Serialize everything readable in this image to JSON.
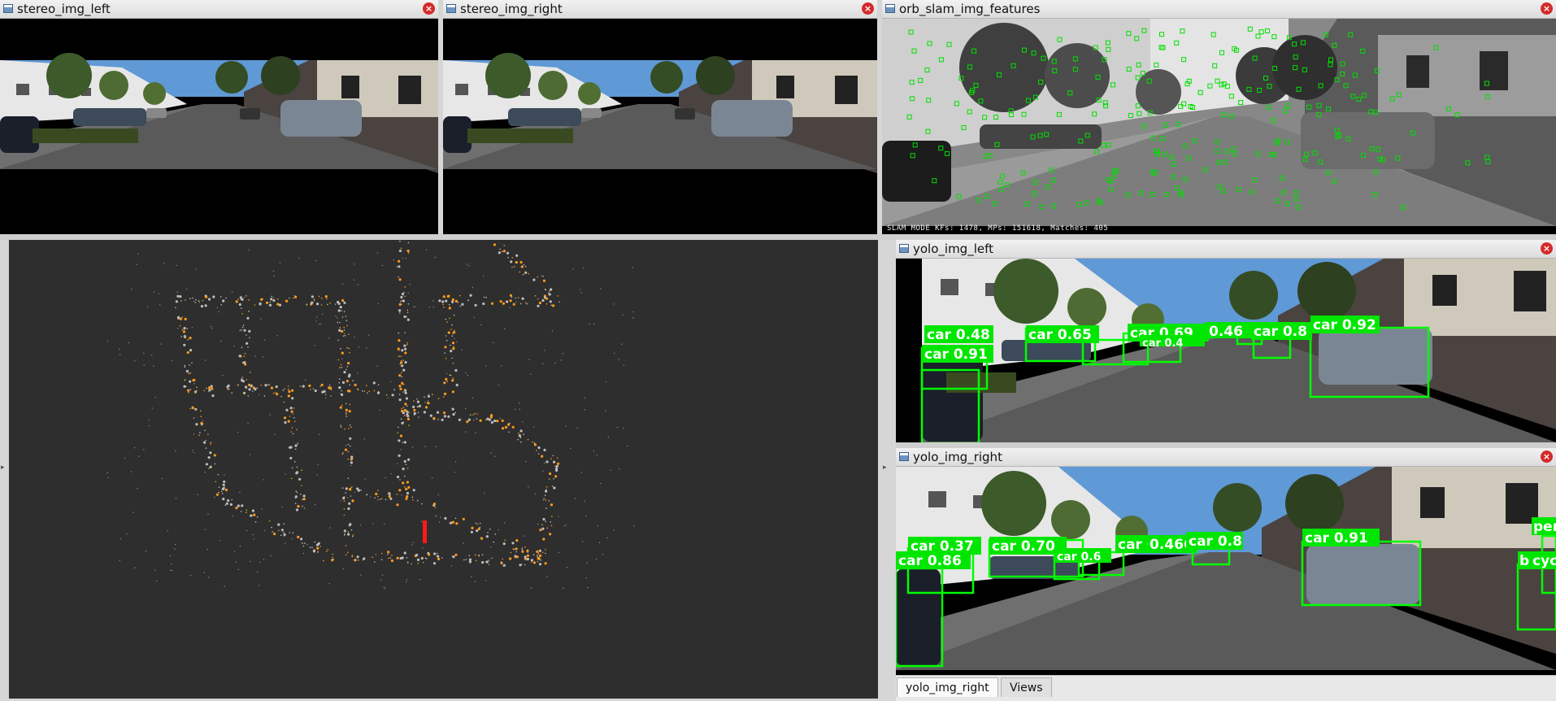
{
  "windows": {
    "stereo_left": {
      "title": "stereo_img_left",
      "close": "×"
    },
    "stereo_right": {
      "title": "stereo_img_right",
      "close": "×"
    },
    "orb_features": {
      "title": "orb_slam_img_features",
      "close": "×",
      "status_text": "SLAM MODE   KFs: 1478, MPs: 151618, Matches: 405"
    },
    "yolo_left": {
      "title": "yolo_img_left",
      "close": "×"
    },
    "yolo_right": {
      "title": "yolo_img_right",
      "close": "×"
    }
  },
  "yolo_left_detections": [
    "car 0.48",
    "car 0.91",
    "car 0.65",
    "car 0.69",
    "car 0.4",
    "0.46",
    "car 0.8",
    "car 0.92"
  ],
  "yolo_right_detections": [
    "car 0.37",
    "car 0.86",
    "car 0.70",
    "car 0.6",
    "car 0.69",
    "0.466",
    "car 0.8",
    "car 0.91",
    "per",
    "b",
    "cyc"
  ],
  "tabs": [
    {
      "label": "yolo_img_right",
      "active": true
    },
    {
      "label": "Views",
      "active": false
    }
  ],
  "colors": {
    "map_background": "#2e2e2e",
    "map_points": "#ff9a1f",
    "detection_box": "#00ff00",
    "feature_marker": "#00e000",
    "camera_pose": "#ff1a1a"
  }
}
